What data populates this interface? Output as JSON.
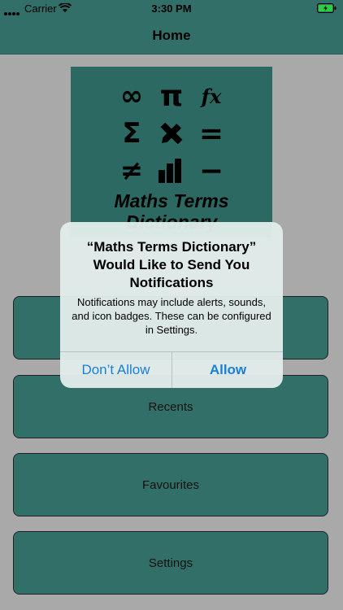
{
  "status_bar": {
    "carrier": "Carrier",
    "time": "3:30 PM",
    "icons": [
      "signal-dots-icon",
      "wifi-icon",
      "battery-charging-icon"
    ]
  },
  "nav": {
    "title": "Home"
  },
  "logo": {
    "symbols": [
      "∞",
      "π",
      "fx",
      "Σ",
      "pencil-ruler-icon",
      "=",
      "≠",
      "bar-chart-icon",
      "−"
    ],
    "title_line1": "Maths Terms",
    "title_line2": "Dictionary"
  },
  "menu": {
    "items": [
      {
        "label": ""
      },
      {
        "label": "Recents"
      },
      {
        "label": "Favourites"
      },
      {
        "label": "Settings"
      }
    ]
  },
  "alert": {
    "title": "“Maths Terms Dictionary” Would Like to Send You Notifications",
    "message": "Notifications may include alerts, sounds, and icon badges. These can be configured in Settings.",
    "deny_label": "Don’t Allow",
    "allow_label": "Allow"
  },
  "colors": {
    "teal": "#336f69",
    "alert_button_blue": "#1a7fd6"
  }
}
